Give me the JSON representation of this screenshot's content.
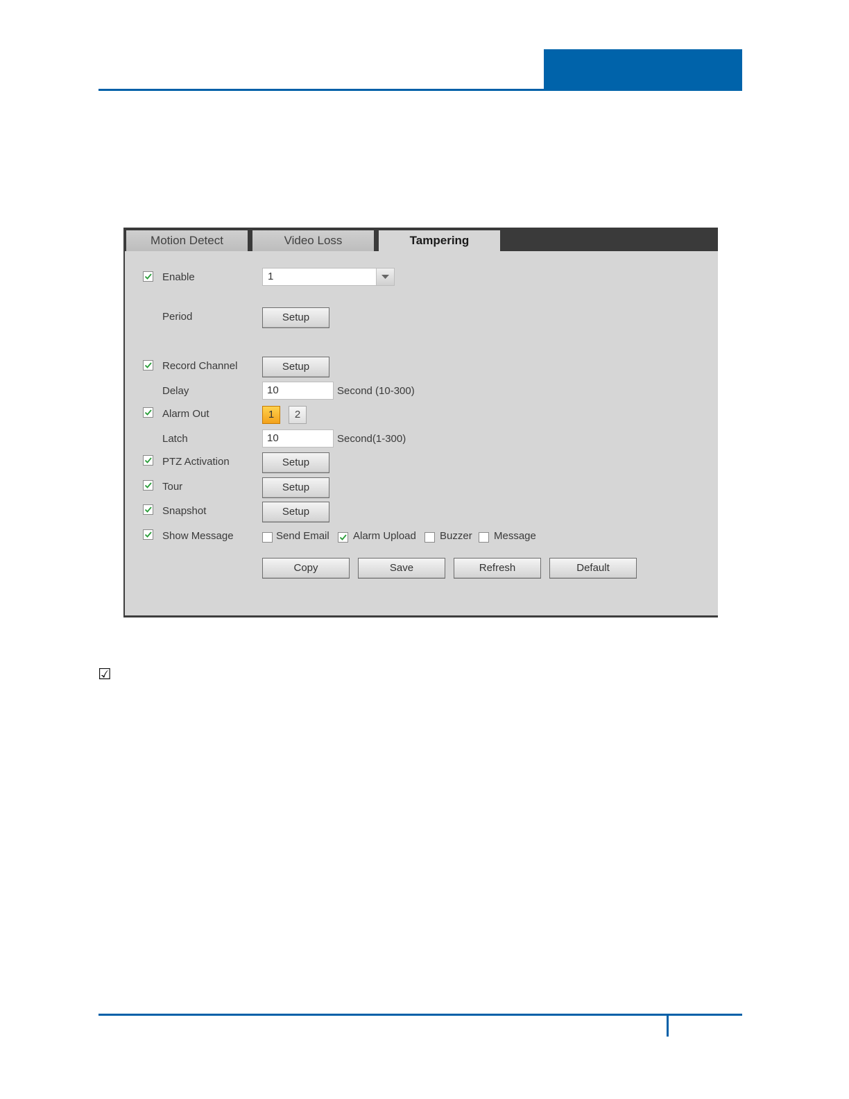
{
  "tabs": [
    {
      "label": "Motion Detect",
      "active": false
    },
    {
      "label": "Video Loss",
      "active": false
    },
    {
      "label": "Tampering",
      "active": true
    }
  ],
  "form": {
    "enable": {
      "label": "Enable",
      "checked": true,
      "selected_channel": "1"
    },
    "period": {
      "label": "Period",
      "button": "Setup"
    },
    "record_channel": {
      "label": "Record Channel",
      "checked": true,
      "button": "Setup"
    },
    "delay": {
      "label": "Delay",
      "value": "10",
      "unit": "Second (10-300)"
    },
    "alarm_out": {
      "label": "Alarm Out",
      "checked": true,
      "channels": [
        "1",
        "2"
      ],
      "selected": "1"
    },
    "latch": {
      "label": "Latch",
      "value": "10",
      "unit": "Second(1-300)"
    },
    "ptz_activation": {
      "label": "PTZ Activation",
      "checked": true,
      "button": "Setup"
    },
    "tour": {
      "label": "Tour",
      "checked": true,
      "button": "Setup"
    },
    "snapshot": {
      "label": "Snapshot",
      "checked": true,
      "button": "Setup"
    },
    "show_message": {
      "label": "Show Message",
      "checked": true
    },
    "options": [
      {
        "label": "Send Email",
        "checked": false
      },
      {
        "label": "Alarm Upload",
        "checked": true
      },
      {
        "label": "Buzzer",
        "checked": false
      },
      {
        "label": "Message",
        "checked": false
      }
    ]
  },
  "actions": {
    "copy": "Copy",
    "save": "Save",
    "refresh": "Refresh",
    "default": "Default"
  },
  "page": {
    "check_glyph": "☑"
  },
  "colors": {
    "brand_blue": "#0063aa",
    "check_green": "#2a9d3a",
    "alarm_active": "#f3a21c"
  }
}
